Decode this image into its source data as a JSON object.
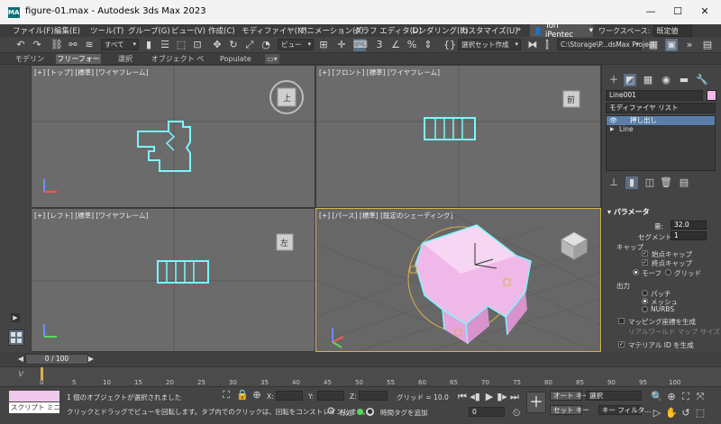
{
  "window": {
    "app_icon": "MAX",
    "title": "figure-01.max - Autodesk 3ds Max 2023",
    "minimize": "—",
    "maximize": "☐",
    "close": "✕"
  },
  "menu": {
    "items": [
      "ファイル(F)",
      "編集(E)",
      "ツール(T)",
      "グループ(G)",
      "ビュー(V)",
      "作成(C)",
      "モディファイヤ(M)",
      "アニメーション(A)",
      "グラフ エディタ(D)",
      "レンダリング(R)",
      "カスタマイズ(U)",
      "»"
    ],
    "user": "Tori iPentec",
    "workspace_label": "ワークスペース:",
    "workspace_value": "既定値"
  },
  "toolbar": {
    "filter_value": "すべて",
    "refcoord_value": "ビュー",
    "selection_set": "選択セット作成",
    "project_path": "C:\\Storage\\P...dsMax Project"
  },
  "ribbon": {
    "tabs": [
      "モデリング",
      "フリーフォーム",
      "選択",
      "オブジェクト ペイント",
      "Populate"
    ],
    "active_index": 1
  },
  "viewports": {
    "top_label": "[+] [トップ] [標準] [ワイヤフレーム]",
    "front_label": "[+] [フロント] [標準] [ワイヤフレーム]",
    "left_label": "[+] [レフト] [標準] [ワイヤフレーム]",
    "persp_label": "[+] [パース] [標準] [既定のシェーディング]",
    "viewcube_top": "上",
    "viewcube_front": "前",
    "viewcube_left": "左"
  },
  "command_panel": {
    "object_name": "Line001",
    "modifier_list": "モディファイヤ リスト",
    "stack": [
      "押し出し",
      "Line"
    ],
    "parameters_title": "パラメータ",
    "amount_label": "量:",
    "amount_value": "32.0",
    "segments_label": "セグメント:",
    "segments_value": "1",
    "capping_title": "キャップ",
    "cap_start": "始点キャップ",
    "cap_end": "終点キャップ",
    "morph": "モーフ",
    "grid": "グリッド",
    "output_title": "出力",
    "patch": "パッチ",
    "mesh": "メッシュ",
    "nurbs": "NURBS",
    "gen_mapping": "マッピング座標を生成",
    "real_world": "リアルワールド マップ サイズ",
    "gen_matid": "マテリアル ID を生成",
    "colors": {
      "object_color": "#f0b8e8",
      "selection": "#5a7ea8"
    }
  },
  "timeline": {
    "frame_display": "0 / 100",
    "ticks": [
      "0",
      "5",
      "10",
      "15",
      "20",
      "25",
      "30",
      "35",
      "40",
      "45",
      "50",
      "55",
      "60",
      "65",
      "70",
      "75",
      "80",
      "85",
      "90",
      "95",
      "100"
    ]
  },
  "status": {
    "script_label": "スクリプト ミニ リス",
    "selection_msg": "1 個のオブジェクトが選択されました",
    "prompt_msg": "クリックとドラッグでビューを回転します。タブ内でのクリックは、回転をコンストレインします。",
    "x_label": "X:",
    "y_label": "Y:",
    "z_label": "Z:",
    "grid": "グリッド = 10.0",
    "enabled_label": "有効:",
    "add_timetag": "時間タグを追加",
    "auto_key": "オート キー",
    "set_key": "セット キー",
    "selected": "選択",
    "key_filter": "キー フィルタ...",
    "frame_field": "0"
  }
}
